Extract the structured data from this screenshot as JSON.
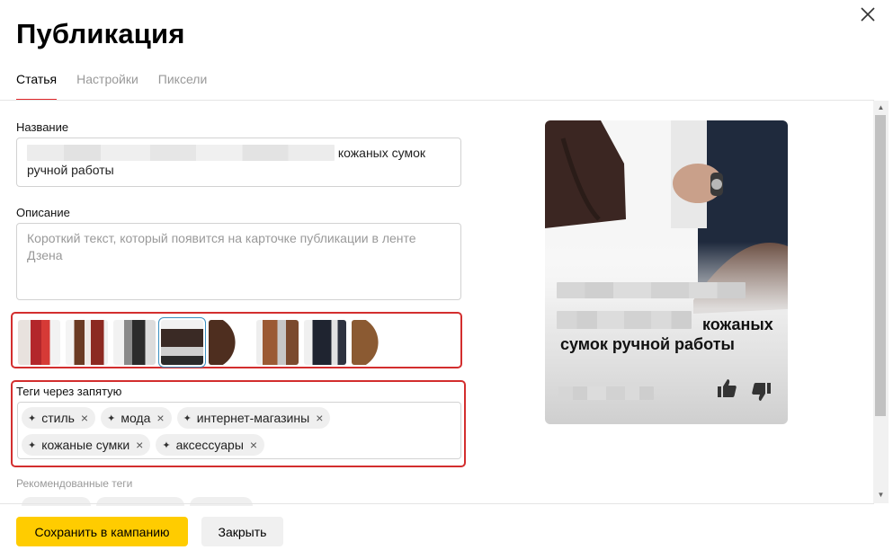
{
  "dialog": {
    "title": "Публикация",
    "close_icon": "close-icon"
  },
  "tabs": [
    {
      "label": "Статья",
      "active": true
    },
    {
      "label": "Настройки",
      "active": false
    },
    {
      "label": "Пиксели",
      "active": false
    }
  ],
  "form": {
    "name_label": "Название",
    "name_value_visible": "кожаных сумок",
    "name_value_line2": "ручной работы",
    "description_label": "Описание",
    "description_placeholder": "Короткий текст, который появится на карточке публикации в ленте Дзена",
    "tags_label": "Теги через запятую",
    "tags": [
      "стиль",
      "мода",
      "интернет-магазины",
      "кожаные сумки",
      "аксессуары"
    ],
    "recommended_label": "Рекомендованные теги"
  },
  "preview": {
    "title_visible": "кожаных",
    "title_line2": "сумок ручной работы",
    "like_icon": "thumbs-up-icon",
    "dislike_icon": "thumbs-down-icon"
  },
  "footer": {
    "save_label": "Сохранить в кампанию",
    "close_label": "Закрыть"
  },
  "colors": {
    "accent_yellow": "#ffcc00",
    "tab_underline": "#e0262a",
    "highlight_red": "#d32e2e"
  }
}
